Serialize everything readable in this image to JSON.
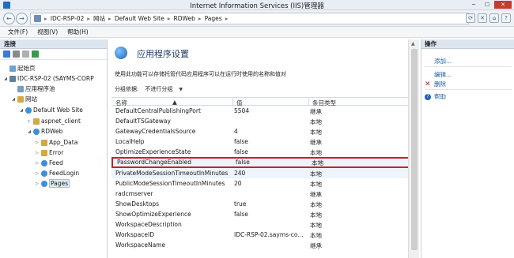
{
  "window": {
    "title": "Internet Information Services (IIS)管理器",
    "buttons": [
      "─",
      "☐",
      "✕"
    ]
  },
  "address": {
    "back": "←",
    "forward": "→",
    "crumbs": [
      "IDC-RSP-02",
      "网站",
      "Default Web Site",
      "RDWeb",
      "Pages"
    ],
    "separator": "▸"
  },
  "menu": [
    "文件(F)",
    "视图(V)",
    "帮助(H)"
  ],
  "connections": {
    "header": "连接",
    "tree": [
      {
        "label": "起始页",
        "level": 0
      },
      {
        "label": "IDC-RSP-02 (SAYMS-CORP",
        "level": 0
      },
      {
        "label": "应用程序池",
        "level": 1
      },
      {
        "label": "网站",
        "level": 1
      },
      {
        "label": "Default Web Site",
        "level": 2
      },
      {
        "label": "aspnet_client",
        "level": 3
      },
      {
        "label": "RDWeb",
        "level": 3
      },
      {
        "label": "App_Data",
        "level": 4
      },
      {
        "label": "Error",
        "level": 4
      },
      {
        "label": "Feed",
        "level": 4
      },
      {
        "label": "FeedLogin",
        "level": 4
      },
      {
        "label": "Pages",
        "level": 4,
        "selected": true
      }
    ]
  },
  "main": {
    "title": "应用程序设置",
    "description": "使用此功能可以存储托管代码应用程序可以在运行时使用的名称和值对",
    "groupby_label": "分组依据:",
    "groupby_value": "不进行分组",
    "columns": [
      "名称",
      "值",
      "条目类型"
    ],
    "rows": [
      {
        "name": "DefaultCentralPublishingPort",
        "value": "5504",
        "type": "继承"
      },
      {
        "name": "DefaultTSGateway",
        "value": "",
        "type": "本地"
      },
      {
        "name": "GatewayCredentialsSource",
        "value": "4",
        "type": "本地"
      },
      {
        "name": "LocalHelp",
        "value": "false",
        "type": "继承"
      },
      {
        "name": "OptimizeExperienceState",
        "value": "false",
        "type": "本地"
      },
      {
        "name": "PasswordChangeEnabled",
        "value": "false",
        "type": "本地",
        "selected": true
      },
      {
        "name": "PrivateModeSessionTimeoutInMinutes",
        "value": "240",
        "type": "本地"
      },
      {
        "name": "PublicModeSessionTimeoutInMinutes",
        "value": "20",
        "type": "本地"
      },
      {
        "name": "radcmserver",
        "value": "",
        "type": "继承"
      },
      {
        "name": "ShowDesktops",
        "value": "true",
        "type": "本地"
      },
      {
        "name": "ShowOptimizeExperience",
        "value": "false",
        "type": "本地"
      },
      {
        "name": "WorkspaceDescription",
        "value": "",
        "type": "本地"
      },
      {
        "name": "WorkspaceID",
        "value": "IDC-RSP-02.sayms-co...",
        "type": "本地"
      },
      {
        "name": "WorkspaceName",
        "value": "",
        "type": "继承"
      }
    ]
  },
  "actions": {
    "header": "操作",
    "items": [
      "添加...",
      "编辑...",
      "删除",
      "帮助"
    ]
  },
  "colors": {
    "accent": "#1f5ea8",
    "highlight_border": "#c8202a",
    "close_button": "#c73a31"
  }
}
